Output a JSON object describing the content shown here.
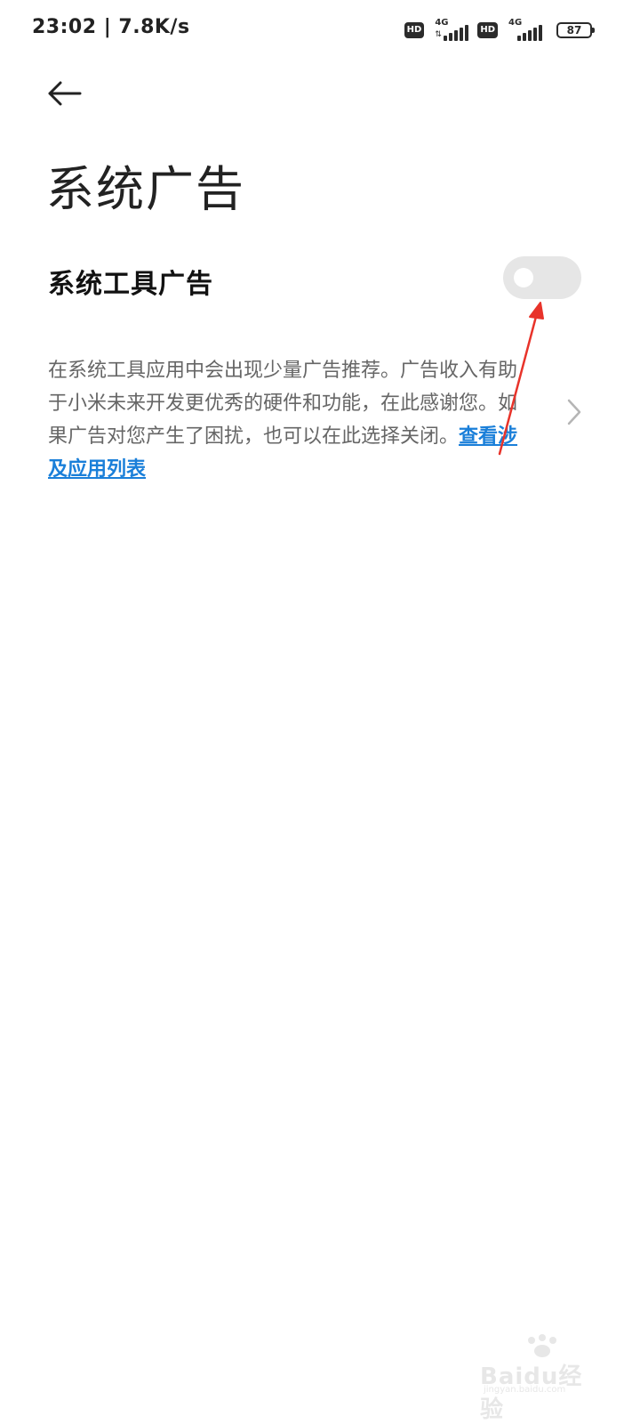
{
  "status_bar": {
    "time": "23:02",
    "speed": "7.8K/s",
    "sim1": {
      "hd": "HD",
      "network": "4G"
    },
    "sim2": {
      "hd": "HD",
      "network": "4G"
    },
    "battery": "87"
  },
  "page": {
    "title": "系统广告"
  },
  "setting": {
    "title": "系统工具广告",
    "toggle_on": false,
    "description": "在系统工具应用中会出现少量广告推荐。广告收入有助于小米未来开发更优秀的硬件和功能，在此感谢您。如果广告对您产生了困扰，也可以在此选择关闭。",
    "link": "查看涉及应用列表"
  },
  "icons": {
    "back": "arrow-left-icon",
    "chevron": "chevron-right-icon"
  },
  "watermark": {
    "text": "Baidu经验",
    "sub": "jingyan.baidu.com"
  },
  "colors": {
    "link": "#1a7fd9",
    "toggle_off": "#e6e6e6",
    "annotation": "#e8332a"
  }
}
